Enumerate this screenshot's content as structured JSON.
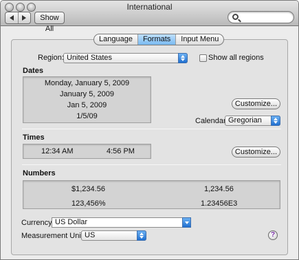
{
  "window": {
    "title": "International"
  },
  "toolbar": {
    "show_all_label": "Show All",
    "search_placeholder": ""
  },
  "tabs": [
    {
      "label": "Language",
      "active": false
    },
    {
      "label": "Formats",
      "active": true
    },
    {
      "label": "Input Menu",
      "active": false
    }
  ],
  "region": {
    "label": "Region:",
    "value": "United States",
    "show_all_label": "Show all regions",
    "show_all_checked": false
  },
  "dates": {
    "heading": "Dates",
    "samples": [
      "Monday, January 5, 2009",
      "January 5, 2009",
      "Jan 5, 2009",
      "1/5/09"
    ],
    "customize_label": "Customize...",
    "calendar_label": "Calendar:",
    "calendar_value": "Gregorian"
  },
  "times": {
    "heading": "Times",
    "samples": [
      "12:34 AM",
      "4:56 PM"
    ],
    "customize_label": "Customize..."
  },
  "numbers": {
    "heading": "Numbers",
    "samples": [
      "$1,234.56",
      "1,234.56",
      "123,456%",
      "1.23456E3"
    ]
  },
  "currency": {
    "label": "Currency:",
    "value": "US Dollar"
  },
  "measurement": {
    "label": "Measurement Units:",
    "value": "US"
  },
  "help": {
    "glyph": "?"
  },
  "colors": {
    "accent": "#3d8ee8",
    "tab_active": "#8fc6f5",
    "panel": "#e3e3e3",
    "help": "#7a2fa8"
  }
}
